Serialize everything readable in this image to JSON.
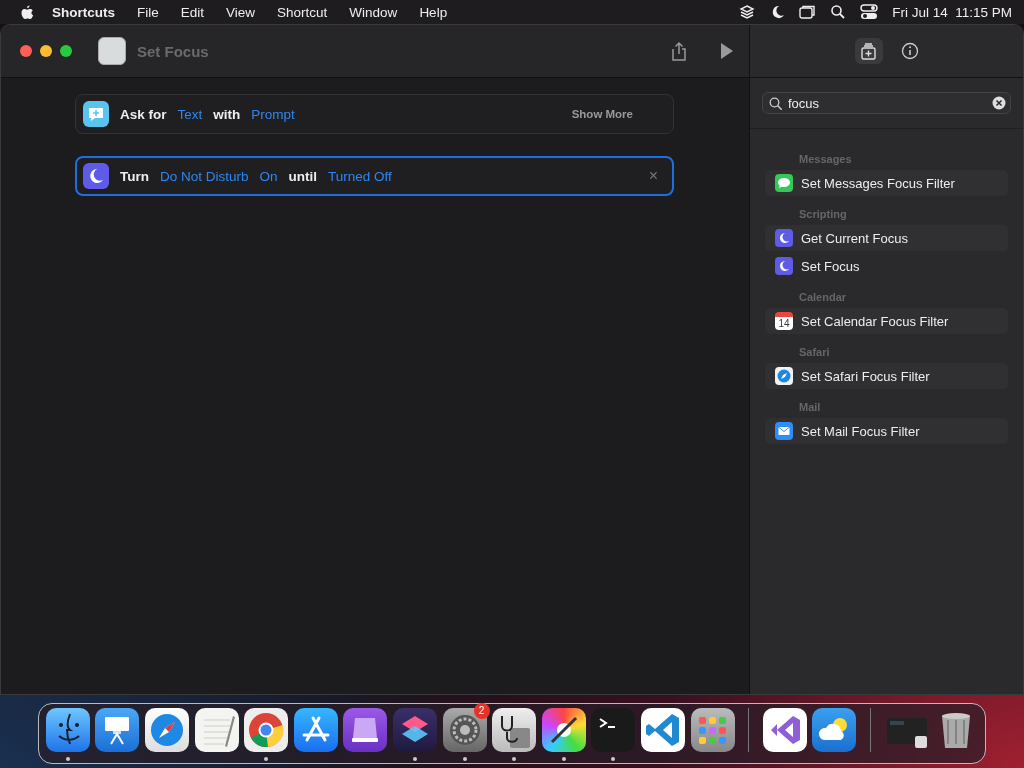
{
  "menu_bar": {
    "app": "Shortcuts",
    "menus": [
      "File",
      "Edit",
      "View",
      "Shortcut",
      "Window",
      "Help"
    ],
    "clock": "Fri Jul 14  11:15 PM"
  },
  "window": {
    "title": "Set Focus"
  },
  "actions": [
    {
      "kind": "ask",
      "selected": false,
      "parts": [
        {
          "text": "Ask for",
          "token": false
        },
        {
          "text": "Text",
          "token": true
        },
        {
          "text": "with",
          "token": false
        },
        {
          "text": "Prompt",
          "token": true
        }
      ],
      "trailing": "Show More"
    },
    {
      "kind": "focus",
      "selected": true,
      "parts": [
        {
          "text": "Turn",
          "token": false
        },
        {
          "text": "Do Not Disturb",
          "token": true
        },
        {
          "text": "On",
          "token": true
        },
        {
          "text": "until",
          "token": false
        },
        {
          "text": "Turned Off",
          "token": true
        }
      ],
      "close": "×"
    }
  ],
  "sidebar": {
    "search": {
      "value": "focus"
    },
    "sections": [
      {
        "title": "Messages",
        "items": [
          {
            "label": "Set Messages Focus Filter",
            "kind": "messages"
          }
        ]
      },
      {
        "title": "Scripting",
        "items": [
          {
            "label": "Get Current Focus",
            "kind": "focus"
          },
          {
            "label": "Set Focus",
            "kind": "focus"
          }
        ]
      },
      {
        "title": "Calendar",
        "items": [
          {
            "label": "Set Calendar Focus Filter",
            "kind": "calendar",
            "icon_text": "14"
          }
        ]
      },
      {
        "title": "Safari",
        "items": [
          {
            "label": "Set Safari Focus Filter",
            "kind": "safari"
          }
        ]
      },
      {
        "title": "Mail",
        "items": [
          {
            "label": "Set Mail Focus Filter",
            "kind": "mail"
          }
        ]
      }
    ]
  },
  "dock": {
    "apps": [
      {
        "kind": "finder",
        "running": true
      },
      {
        "kind": "keynote",
        "running": false
      },
      {
        "kind": "safari",
        "running": false
      },
      {
        "kind": "textedit",
        "running": false
      },
      {
        "kind": "chrome",
        "running": true
      },
      {
        "kind": "appstore",
        "running": false
      },
      {
        "kind": "purple",
        "running": false
      },
      {
        "kind": "shortcuts",
        "running": true
      },
      {
        "kind": "settings",
        "running": true,
        "badge": "2"
      },
      {
        "kind": "diskutility",
        "running": true
      },
      {
        "kind": "colorsync",
        "running": true
      },
      {
        "kind": "terminal",
        "running": true
      },
      {
        "kind": "vscode",
        "running": false
      },
      {
        "kind": "launchpad",
        "running": false
      },
      {
        "kind": "divider"
      },
      {
        "kind": "visualstudio",
        "running": false
      },
      {
        "kind": "weather",
        "running": false
      },
      {
        "kind": "divider"
      },
      {
        "kind": "window",
        "running": false
      },
      {
        "kind": "trash",
        "running": false
      }
    ]
  }
}
